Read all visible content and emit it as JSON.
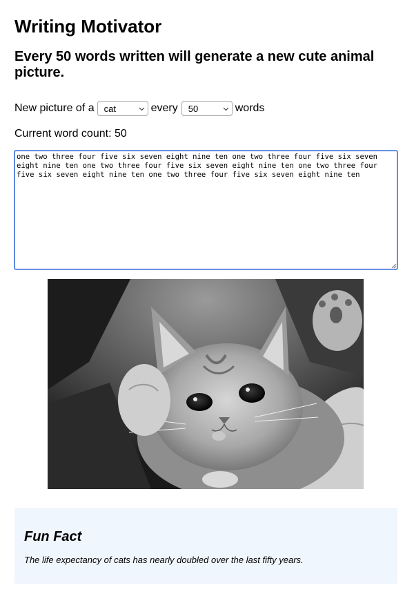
{
  "page": {
    "title": "Writing Motivator",
    "subtitle": "Every 50 words written will generate a new cute animal picture."
  },
  "controls": {
    "prefix": "New picture of a",
    "animal_selected": "cat",
    "middle": "every",
    "count_selected": "50",
    "suffix": "words"
  },
  "status": {
    "word_count_text": "Current word count: 50"
  },
  "editor": {
    "text": "one two three four five six seven eight nine ten one two three four five six seven eight nine ten one two three four five six seven eight nine ten one two three four five six seven eight nine ten one two three four five six seven eight nine ten"
  },
  "image": {
    "subject": "cat"
  },
  "fun_fact": {
    "heading": "Fun Fact",
    "text": "The life expectancy of cats has nearly doubled over the last fifty years."
  }
}
